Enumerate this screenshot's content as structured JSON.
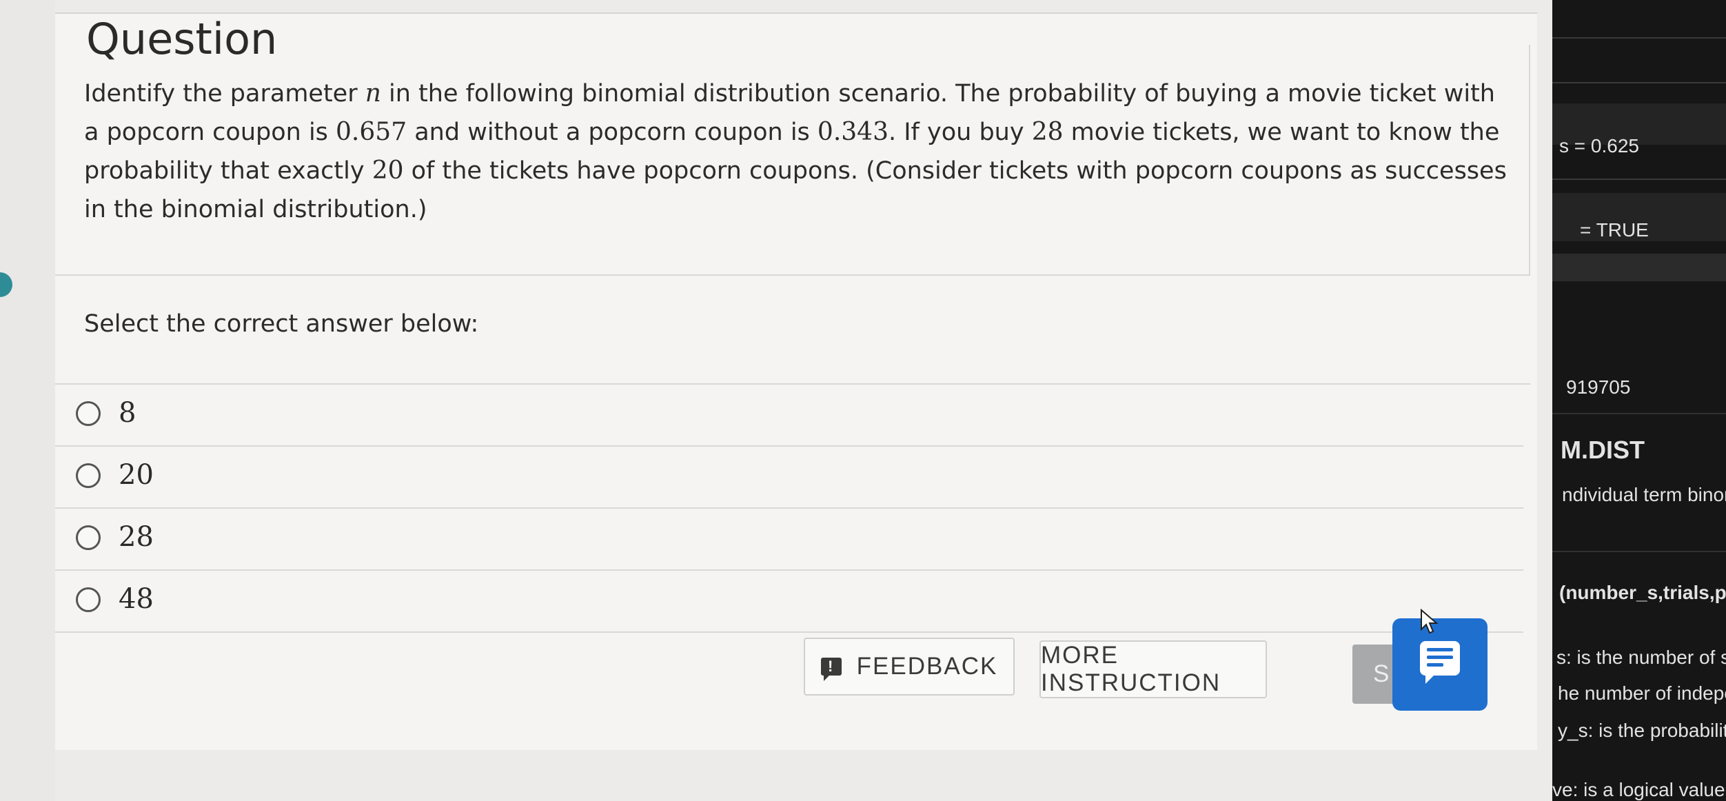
{
  "question": {
    "heading": "Question",
    "lines": [
      {
        "a": "Identify the parameter ",
        "b": "n",
        "c": " in the following binomial distribution scenario. The probability of buying a movie ticket with"
      },
      {
        "a": "a popcorn coupon is ",
        "b": "0.657",
        "c": " and without a popcorn coupon is ",
        "d": "0.343",
        "e": ". If you buy ",
        "f": "28",
        "g": " movie tickets, we want to know the"
      },
      {
        "a": "probability that exactly ",
        "b": "20",
        "c": " of the tickets have popcorn coupons. (Consider tickets with popcorn coupons as successes"
      },
      {
        "a": "in the binomial distribution.)"
      }
    ]
  },
  "prompt": "Select the correct answer below:",
  "options": [
    {
      "label": "8",
      "selected": false
    },
    {
      "label": "20",
      "selected": false
    },
    {
      "label": "28",
      "selected": false
    },
    {
      "label": "48",
      "selected": false
    }
  ],
  "footer": {
    "feedback_label": "FEEDBACK",
    "feedback_icon_glyph": "!",
    "more_label": "MORE INSTRUCTION",
    "submit_partial_label": "S"
  },
  "right_panel": {
    "line1": "s  =  0.625",
    "line2": "=  TRUE",
    "line3": "919705",
    "line4": "M.DIST",
    "line5": "ndividual term binomia",
    "line6": "(number_s,trials,prob",
    "line7": "s: is the number of succ",
    "line8": "he number of independ",
    "line9": "y_s: is the probability o",
    "line10": "ve: is a logical value: fo"
  },
  "colors": {
    "accent_blue": "#1f6fcf",
    "teal_dot": "#2e8c96",
    "submit_gray": "#a8a9ab",
    "dark_panel": "#161616"
  }
}
